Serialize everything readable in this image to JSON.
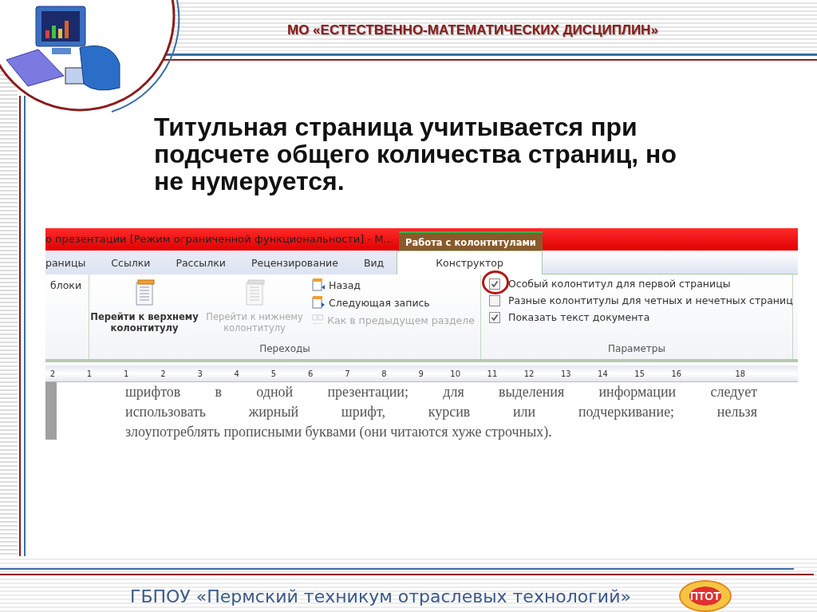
{
  "header": {
    "title": "МО «ЕСТЕСТВЕННО-МАТЕМАТИЧЕСКИХ ДИСЦИПЛИН»"
  },
  "heading": "Титульная страница учитывается при подсчете общего количества страниц, но не нумеруется.",
  "word": {
    "window_title": "о презентации [Режим ограниченной функциональности]  -  М...",
    "context_group": "Работа с колонтитулами",
    "tabs": [
      {
        "label": "раницы",
        "selected": false
      },
      {
        "label": "Ссылки",
        "selected": false
      },
      {
        "label": "Рассылки",
        "selected": false
      },
      {
        "label": "Рецензирование",
        "selected": false
      },
      {
        "label": "Вид",
        "selected": false
      },
      {
        "label": "Конструктор",
        "selected": true
      }
    ],
    "blocks_label": "блоки",
    "navigation": {
      "large_buttons": [
        {
          "label": "Перейти к верхнему колонтитулу",
          "disabled": false
        },
        {
          "label": "Перейти к нижнему колонтитулу",
          "disabled": true
        }
      ],
      "small_buttons": [
        {
          "label": "Назад",
          "kind": "back",
          "disabled": false
        },
        {
          "label": "Следующая запись",
          "kind": "next",
          "disabled": false
        },
        {
          "label": "Как в предыдущем разделе",
          "kind": "link",
          "disabled": true
        }
      ],
      "group_label": "Переходы"
    },
    "options": {
      "items": [
        {
          "label": "Особый колонтитул для первой страницы",
          "checked": true,
          "highlighted": true
        },
        {
          "label": "Разные колонтитулы для четных и нечетных страниц",
          "checked": false,
          "highlighted": false
        },
        {
          "label": "Показать текст документа",
          "checked": true,
          "highlighted": false
        }
      ],
      "group_label": "Параметры"
    },
    "ruler": [
      "2",
      "1",
      "1",
      "2",
      "3",
      "4",
      "5",
      "6",
      "7",
      "8",
      "9",
      "10",
      "11",
      "12",
      "13",
      "14",
      "15",
      "16",
      "18"
    ],
    "document_lines": [
      "шрифтов в одной презентации; для выделения информации следует",
      "использовать жирный шрифт, курсив или подчеркивание; нельзя",
      "злоупотреблять прописными буквами (они читаются хуже строчных)."
    ]
  },
  "footer": {
    "text": "ГБПОУ «Пермский техникум отраслевых технологий»",
    "logo_text": "ПТОТ"
  }
}
